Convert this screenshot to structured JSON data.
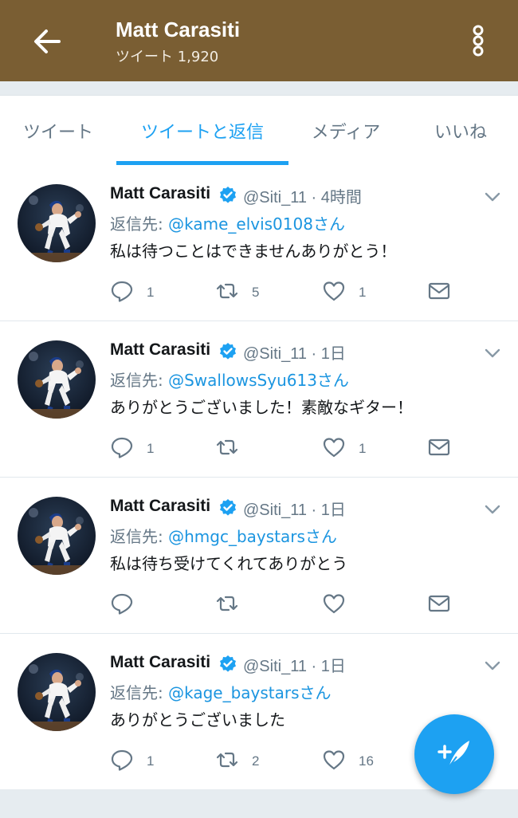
{
  "header": {
    "title": "Matt Carasiti",
    "subtitle": "ツイート 1,920"
  },
  "tabs": [
    {
      "label": "ツイート"
    },
    {
      "label": "ツイートと返信",
      "active": true
    },
    {
      "label": "メディア"
    },
    {
      "label": "いいね"
    }
  ],
  "colors": {
    "appbar": "#7a5e33",
    "accent": "#1da1f2",
    "mention": "#1b95e0",
    "secondary_text": "#657786"
  },
  "tweets": [
    {
      "name": "Matt Carasiti",
      "handle_time": "@Siti_11 · 4時間",
      "reply_prefix": "返信先: ",
      "reply_to": "@kame_elvis0108さん",
      "text": "私は待つことはできませんありがとう！",
      "replies": "1",
      "retweets": "5",
      "likes": "1"
    },
    {
      "name": "Matt Carasiti",
      "handle_time": "@Siti_11 · 1日",
      "reply_prefix": "返信先: ",
      "reply_to": "@SwallowsSyu613さん",
      "text": "ありがとうございました！素敵なギター！",
      "replies": "1",
      "retweets": "",
      "likes": "1"
    },
    {
      "name": "Matt Carasiti",
      "handle_time": "@Siti_11 · 1日",
      "reply_prefix": "返信先: ",
      "reply_to": "@hmgc_baystarsさん",
      "text": "私は待ち受けてくれてありがとう",
      "replies": "",
      "retweets": "",
      "likes": ""
    },
    {
      "name": "Matt Carasiti",
      "handle_time": "@Siti_11 · 1日",
      "reply_prefix": "返信先: ",
      "reply_to": "@kage_baystarsさん",
      "text": "ありがとうございました",
      "replies": "1",
      "retweets": "2",
      "likes": "16"
    }
  ],
  "icons": {
    "back": "arrow-left-icon",
    "menu": "more-vertical-icon",
    "verified": "verified-badge-icon",
    "caret": "chevron-down-icon",
    "reply": "reply-icon",
    "retweet": "retweet-icon",
    "like": "heart-icon",
    "dm": "envelope-icon",
    "compose": "compose-feather-icon"
  }
}
